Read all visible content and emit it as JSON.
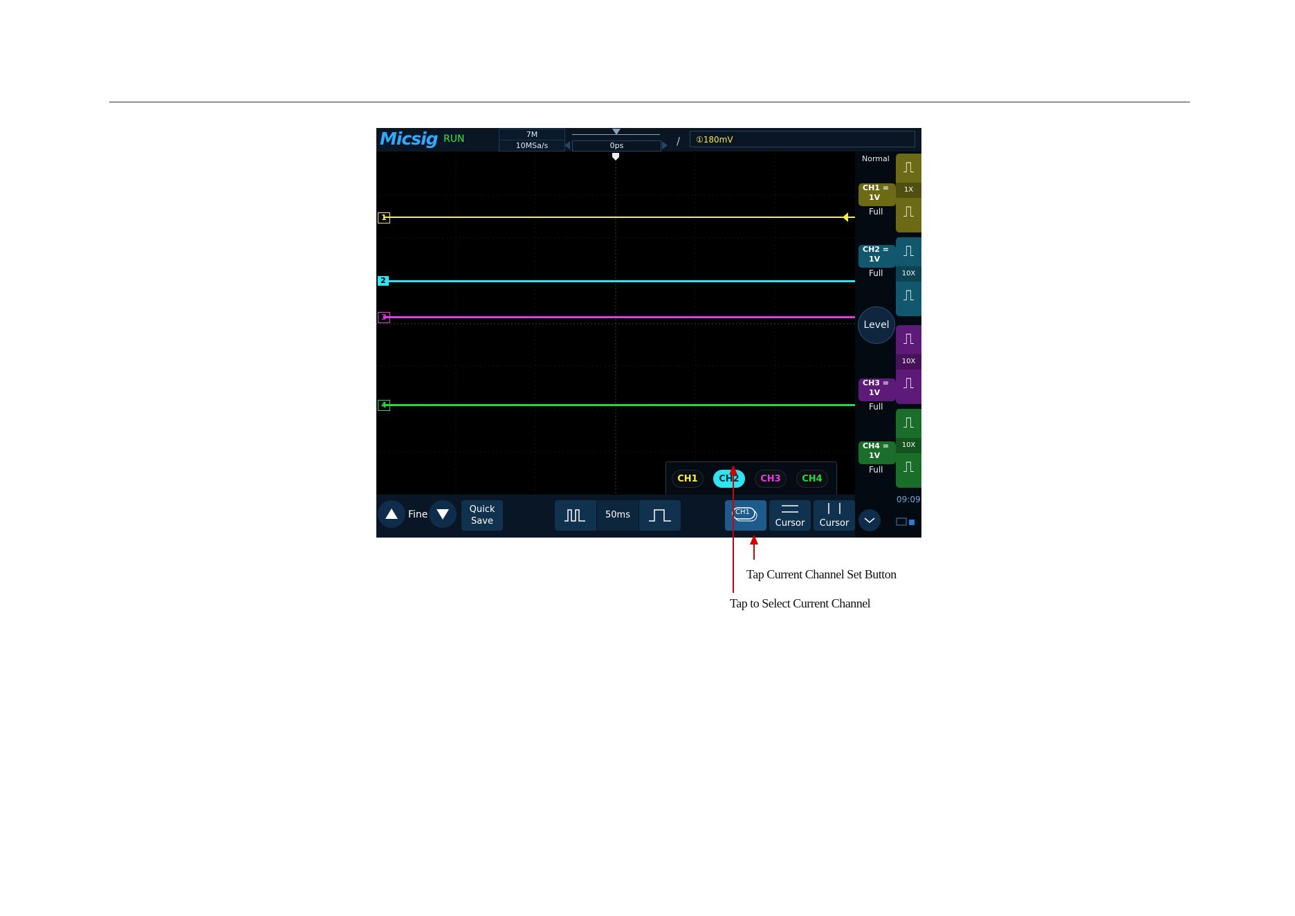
{
  "oscilloscope": {
    "brand": "Micsig",
    "status": "RUN",
    "memory_depth": "7M",
    "sample_rate": "10MSa/s",
    "horizontal_position": "0ps",
    "trigger_level": "①180mV",
    "trigger_mode": "Normal",
    "time": "09:09",
    "channels": [
      {
        "label": "CH1",
        "scale": "1V",
        "coupling_symbol": "=",
        "bandwidth": "Full",
        "probe": "1X",
        "color": "#f4ef3a",
        "panel_color": "#6d6a16",
        "marker": "1"
      },
      {
        "label": "CH2",
        "scale": "1V",
        "coupling_symbol": "=",
        "bandwidth": "Full",
        "probe": "10X",
        "color": "#2fe3f0",
        "panel_color": "#11586e",
        "marker": "2"
      },
      {
        "label": "CH3",
        "scale": "1V",
        "coupling_symbol": "=",
        "bandwidth": "Full",
        "probe": "10X",
        "color": "#e23be6",
        "panel_color": "#5e1a78",
        "marker": "3"
      },
      {
        "label": "CH4",
        "scale": "1V",
        "coupling_symbol": "=",
        "bandwidth": "Full",
        "probe": "10X",
        "color": "#27d83d",
        "panel_color": "#1b6e2a",
        "marker": "4"
      }
    ],
    "level_knob": "Level",
    "bottom": {
      "fine": "Fine",
      "quick_save_line1": "Quick",
      "quick_save_line2": "Save",
      "timebase": "50ms",
      "current_channel": "CH1",
      "cursor_h": "Cursor",
      "cursor_v": "Cursor"
    },
    "channel_selector": [
      "CH1",
      "CH2",
      "CH3",
      "CH4"
    ],
    "selected_channel": "CH2"
  },
  "annotations": {
    "set_button": "Tap Current Channel Set Button",
    "select_channel": "Tap to Select Current Channel"
  }
}
